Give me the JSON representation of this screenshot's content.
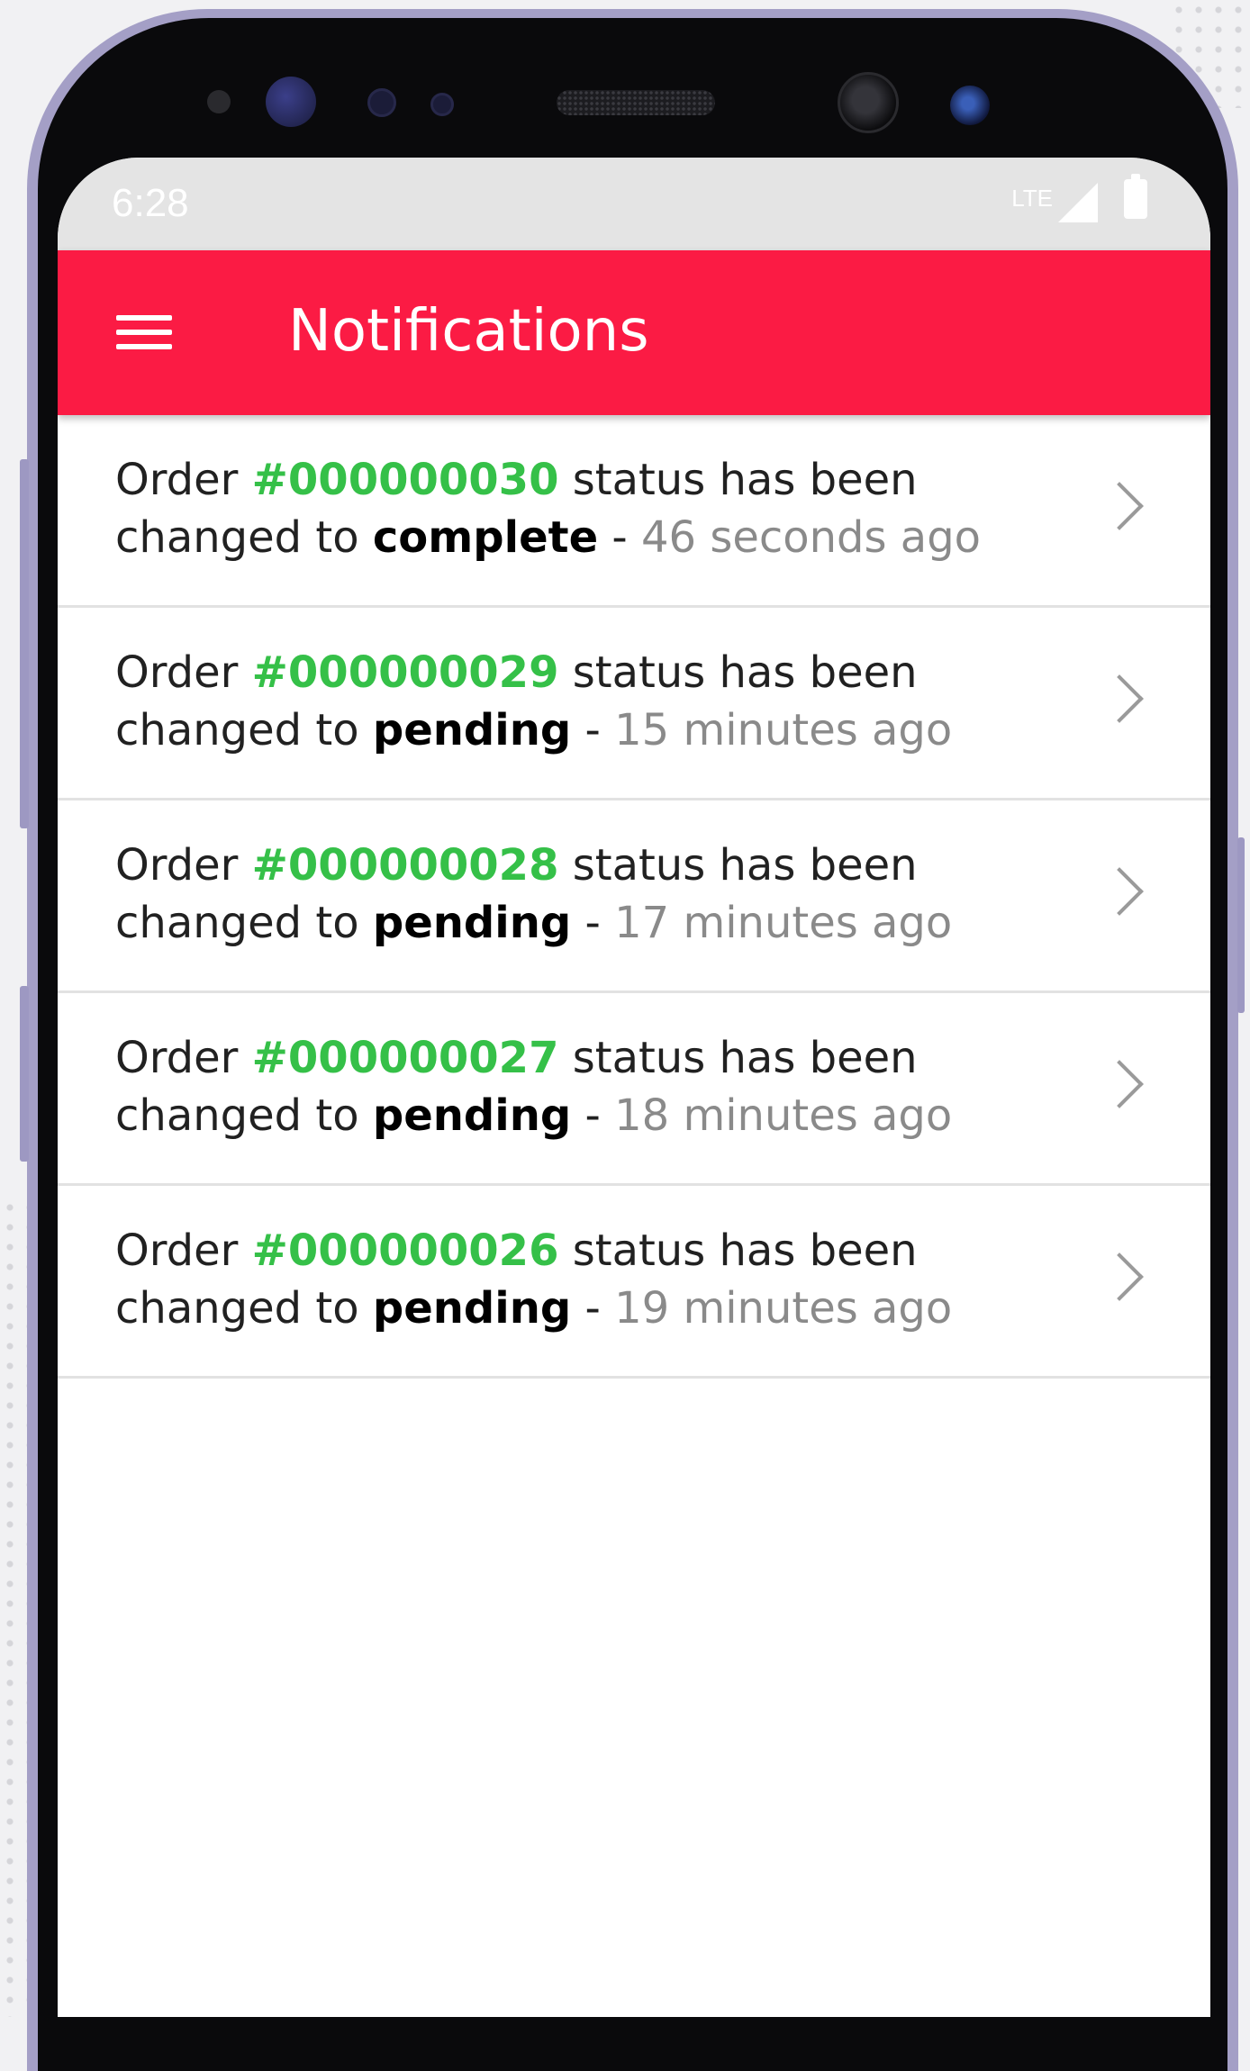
{
  "status_bar": {
    "time": "6:28",
    "network": "LTE",
    "icons": [
      "signal-icon",
      "battery-icon"
    ]
  },
  "app_bar": {
    "title": "Notifications",
    "menu_icon": "hamburger-menu-icon",
    "color": "#fb1b44"
  },
  "notifications": [
    {
      "prefix": "Order ",
      "order_id": "#000000030",
      "middle": " status has been changed to ",
      "status": "complete",
      "separator": " - ",
      "time": "46 seconds ago"
    },
    {
      "prefix": "Order ",
      "order_id": "#000000029",
      "middle": " status has been changed to ",
      "status": "pending",
      "separator": " - ",
      "time": "15 minutes ago"
    },
    {
      "prefix": "Order ",
      "order_id": "#000000028",
      "middle": " status has been changed to ",
      "status": "pending",
      "separator": " - ",
      "time": "17 minutes ago"
    },
    {
      "prefix": "Order ",
      "order_id": "#000000027",
      "middle": " status has been changed to ",
      "status": "pending",
      "separator": " - ",
      "time": "18 minutes ago"
    },
    {
      "prefix": "Order ",
      "order_id": "#000000026",
      "middle": " status has been changed to ",
      "status": "pending",
      "separator": " - ",
      "time": "19 minutes ago"
    }
  ],
  "colors": {
    "order_id": "#35c048",
    "time": "#8a8a8a",
    "app_bar": "#fb1b44"
  }
}
